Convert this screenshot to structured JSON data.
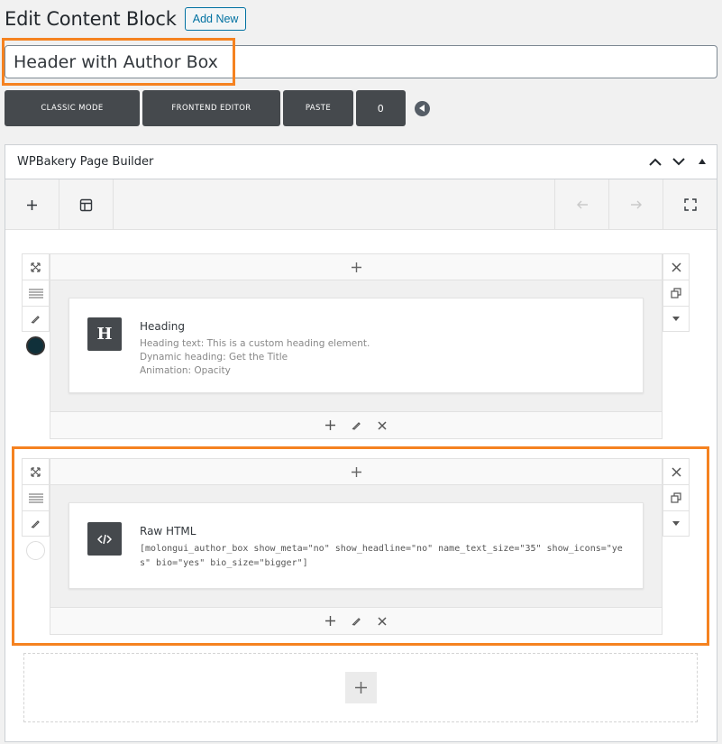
{
  "header": {
    "title": "Edit Content Block",
    "add_new_label": "Add New"
  },
  "title_field": {
    "value": "Header with Author Box"
  },
  "toolbar": {
    "classic_mode": "CLASSIC MODE",
    "frontend_editor": "FRONTEND EDITOR",
    "paste": "PASTE",
    "count": "0"
  },
  "builder": {
    "title": "WPBakery Page Builder",
    "icons": {
      "add": "plus-icon",
      "templates": "template-icon",
      "undo": "arrow-left-icon",
      "redo": "arrow-right-icon",
      "fullscreen": "fullscreen-icon"
    }
  },
  "rows": [
    {
      "dot_color": "#10303a",
      "element": {
        "icon_letter": "H",
        "name": "Heading",
        "lines": [
          "Heading text: This is a custom heading element.",
          "Dynamic heading: Get the Title",
          "Animation: Opacity"
        ]
      }
    },
    {
      "dot_color": "#ffffff",
      "element": {
        "name": "Raw HTML",
        "code": "[molongui_author_box show_meta=\"no\" show_headline=\"no\" name_text_size=\"35\" show_icons=\"yes\" bio=\"yes\" bio_size=\"bigger\"]"
      }
    }
  ],
  "colors": {
    "highlight": "#f58220",
    "button_dark": "#45494d",
    "link_blue": "#0071a1"
  }
}
